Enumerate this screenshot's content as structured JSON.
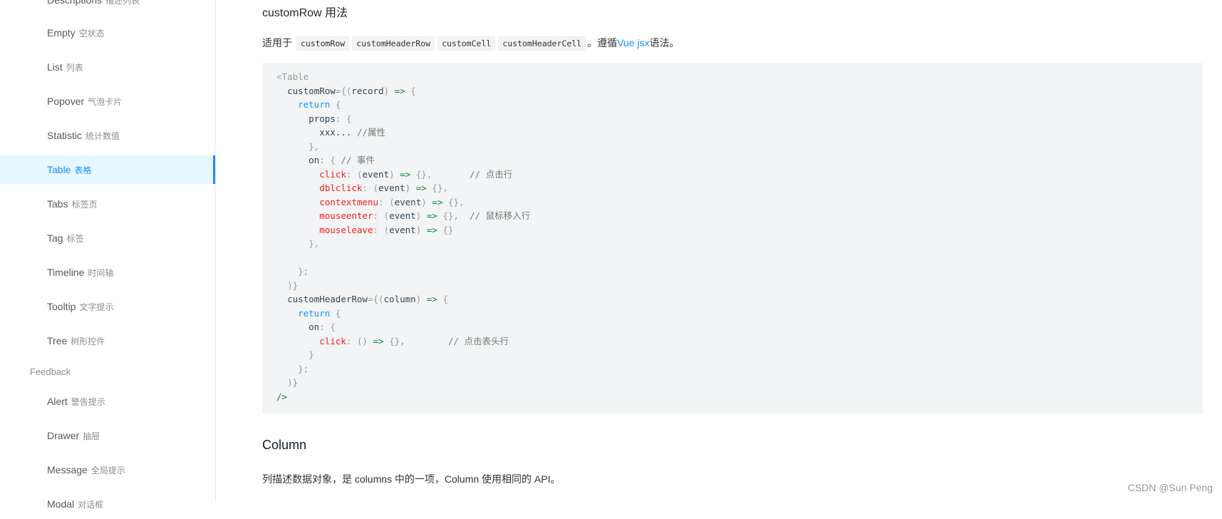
{
  "sidebar": {
    "items": [
      {
        "label": "Descriptions",
        "sub": "描述列表"
      },
      {
        "label": "Empty",
        "sub": "空状态"
      },
      {
        "label": "List",
        "sub": "列表"
      },
      {
        "label": "Popover",
        "sub": "气泡卡片"
      },
      {
        "label": "Statistic",
        "sub": "统计数值"
      },
      {
        "label": "Table",
        "sub": "表格"
      },
      {
        "label": "Tabs",
        "sub": "标签页"
      },
      {
        "label": "Tag",
        "sub": "标签"
      },
      {
        "label": "Timeline",
        "sub": "时间轴"
      },
      {
        "label": "Tooltip",
        "sub": "文字提示"
      },
      {
        "label": "Tree",
        "sub": "树形控件"
      }
    ],
    "group": "Feedback",
    "items2": [
      {
        "label": "Alert",
        "sub": "警告提示"
      },
      {
        "label": "Drawer",
        "sub": "抽屉"
      },
      {
        "label": "Message",
        "sub": "全局提示"
      },
      {
        "label": "Modal",
        "sub": "对话框"
      }
    ]
  },
  "content": {
    "section_title": "customRow 用法",
    "intro_prefix": "适用于",
    "codes": [
      "customRow",
      "customHeaderRow",
      "customCell",
      "customHeaderCell"
    ],
    "intro_mid": "。遵循",
    "intro_link": "Vue jsx",
    "intro_suffix": "语法。",
    "code": {
      "open_tag": "<Table",
      "attr_row": "customRow",
      "arg_record": "record",
      "kw_return": "return",
      "props": "props",
      "xxx": "xxx...",
      "cmt_props": "//属性",
      "on": "on",
      "cmt_events": "// 事件",
      "ev_click": "click",
      "ev_dblclick": "dblclick",
      "ev_contextmenu": "contextmenu",
      "ev_mouseenter": "mouseenter",
      "ev_mouseleave": "mouseleave",
      "arg_event": "event",
      "cmt_click": "// 点击行",
      "cmt_mouseenter": "// 鼠标移入行",
      "attr_header": "customHeaderRow",
      "arg_column": "column",
      "cmt_header_click": "// 点击表头行",
      "close_tag": "/>"
    },
    "column_title": "Column",
    "column_desc": "列描述数据对象，是 columns 中的一项，Column 使用相同的 API。"
  },
  "watermark": "CSDN @Sun  Peng"
}
